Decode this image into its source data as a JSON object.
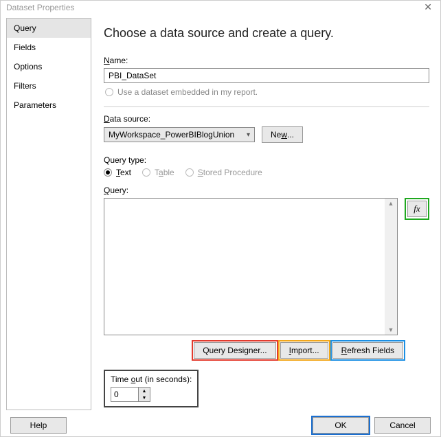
{
  "window": {
    "title": "Dataset Properties"
  },
  "sidebar": {
    "items": [
      {
        "label": "Query"
      },
      {
        "label": "Fields"
      },
      {
        "label": "Options"
      },
      {
        "label": "Filters"
      },
      {
        "label": "Parameters"
      }
    ],
    "active_index": 0
  },
  "main": {
    "heading": "Choose a data source and create a query.",
    "name_label": "Name:",
    "name_value": "PBI_DataSet",
    "embedded_label": "Use a dataset embedded in my report.",
    "datasource_label": "Data source:",
    "datasource_value": "MyWorkspace_PowerBIBlogUnion",
    "new_button": "New...",
    "querytype_label": "Query type:",
    "querytype_options": [
      "Text",
      "Table",
      "Stored Procedure"
    ],
    "querytype_selected": 0,
    "query_label": "Query:",
    "query_value": "",
    "fx_label": "fx",
    "query_designer": "Query Designer...",
    "import": "Import...",
    "refresh_fields": "Refresh Fields",
    "timeout_label": "Time out (in seconds):",
    "timeout_value": "0"
  },
  "footer": {
    "help": "Help",
    "ok": "OK",
    "cancel": "Cancel"
  }
}
